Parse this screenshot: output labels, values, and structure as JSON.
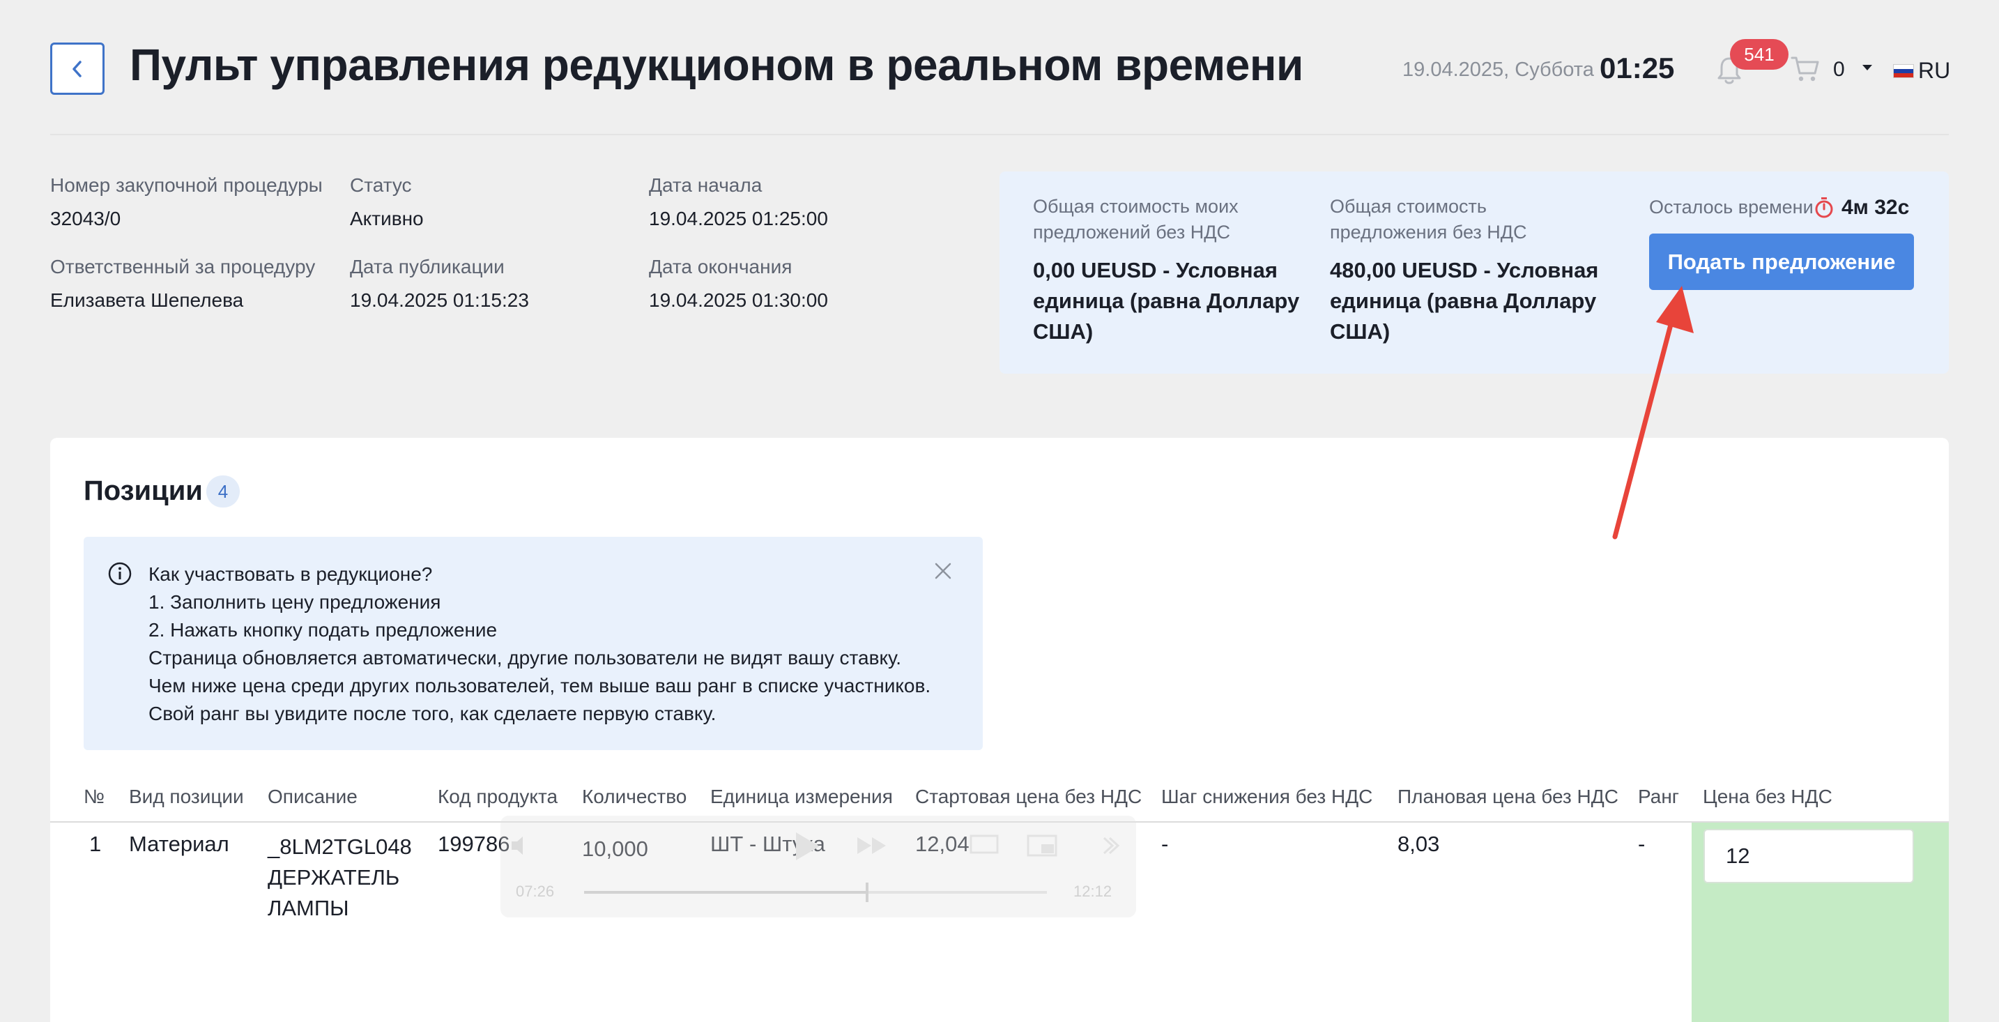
{
  "header": {
    "title": "Пульт управления редукционом в реальном времени",
    "date": "19.04.2025, Суббота",
    "time": "01:25",
    "notifications_count": "541",
    "cart_count": "0",
    "language": "RU"
  },
  "info": {
    "procedure_number_label": "Номер закупочной процедуры",
    "procedure_number": "32043/0",
    "status_label": "Статус",
    "status": "Активно",
    "start_date_label": "Дата начала",
    "start_date": "19.04.2025 01:25:00",
    "responsible_label": "Ответственный за процедуру",
    "responsible": "Елизавета Шепелева",
    "publish_date_label": "Дата публикации",
    "publish_date": "19.04.2025 01:15:23",
    "end_date_label": "Дата окончания",
    "end_date": "19.04.2025 01:30:00"
  },
  "panel": {
    "my_total_label_1": "Общая стоимость моих",
    "my_total_label_2": "предложений без НДС",
    "my_total_1": "0,00 UEUSD - Условная",
    "my_total_2": "единица (равна Доллару",
    "my_total_3": "США)",
    "offer_total_label_1": "Общая стоимость",
    "offer_total_label_2": "предложения без НДС",
    "offer_total_1": "480,00 UEUSD - Условная",
    "offer_total_2": "единица (равна Доллару",
    "offer_total_3": "США)",
    "time_left_label": "Осталось времени",
    "time_left": "4м 32с",
    "submit_label": "Подать предложение"
  },
  "positions": {
    "title": "Позиции",
    "count": "4",
    "notice": {
      "line1": "Как участвовать в редукционе?",
      "line2": "1. Заполнить цену предложения",
      "line3": "2. Нажать кнопку подать предложение",
      "line4": "Страница обновляется автоматически, другие пользователи не видят вашу ставку.",
      "line5": "Чем ниже цена среди других пользователей, тем выше ваш ранг в списке участников.",
      "line6": "Свой ранг вы увидите после того, как сделаете первую ставку."
    },
    "columns": {
      "num": "№",
      "type": "Вид позиции",
      "description": "Описание",
      "product_code": "Код продукта",
      "quantity": "Количество",
      "unit": "Единица измерения",
      "start_price": "Стартовая цена без НДС",
      "step": "Шаг снижения без НДС",
      "planned_price": "Плановая цена без НДС",
      "rank": "Ранг",
      "price": "Цена без НДС"
    },
    "rows": [
      {
        "num": "1",
        "type": "Материал",
        "description_1": "_8LM2TGL048",
        "description_2": "ДЕРЖАТЕЛЬ",
        "description_3": "ЛАМПЫ",
        "product_code": "199786",
        "quantity": "10,000",
        "unit": "ШТ - Штука",
        "start_price": "12,04",
        "step": "-",
        "planned_price": "8,03",
        "rank": "-",
        "price": "12"
      }
    ]
  },
  "video_overlay": {
    "elapsed": "07:26",
    "total": "12:12"
  },
  "colors": {
    "accent": "#4a87e2",
    "badge": "#e54b55",
    "panel_bg": "#e9f1fc",
    "price_col_bg": "#c5ebc5",
    "annotation_arrow": "#e8443a"
  }
}
